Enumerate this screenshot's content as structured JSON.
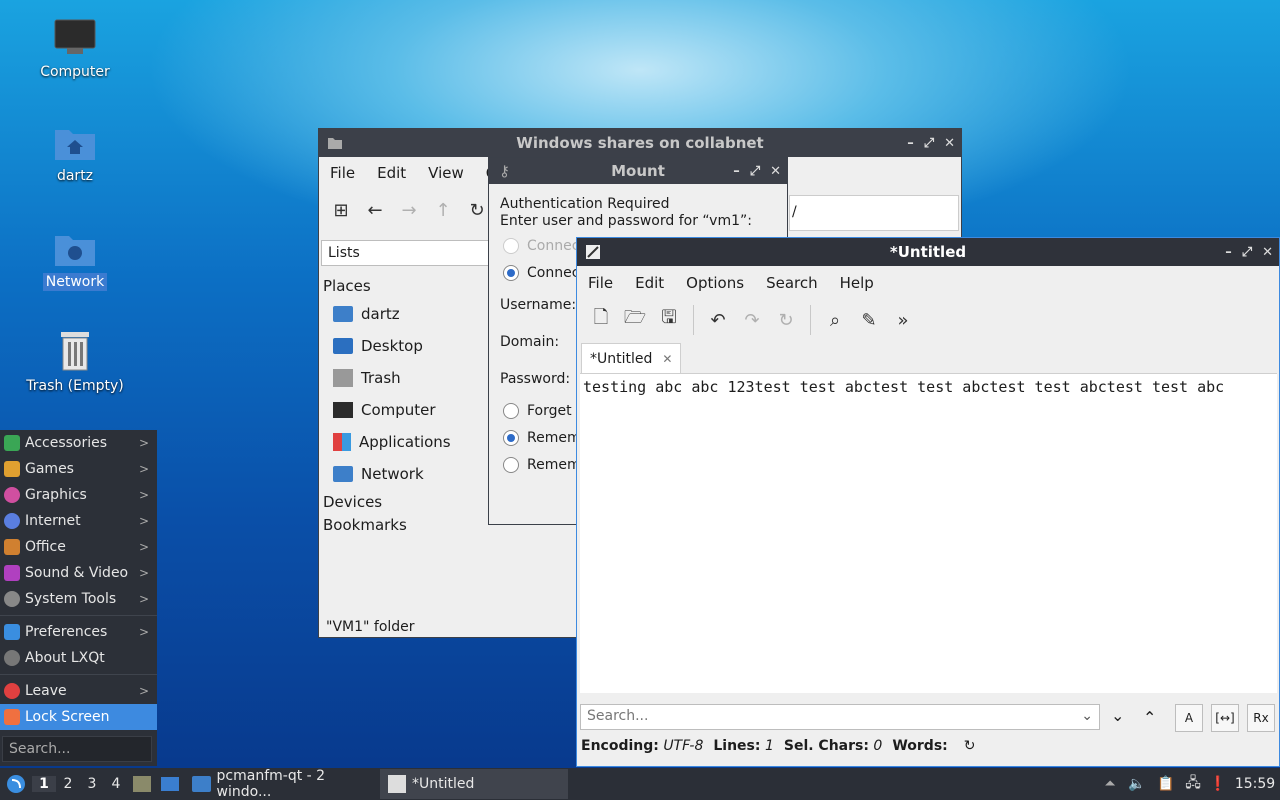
{
  "desktop": {
    "icons": [
      {
        "label": "Computer"
      },
      {
        "label": "dartz"
      },
      {
        "label": "Network"
      },
      {
        "label": "Trash (Empty)"
      }
    ]
  },
  "filemanager": {
    "title": "Windows shares on collabnet",
    "menu": [
      "File",
      "Edit",
      "View",
      "Go"
    ],
    "sidepane_mode": "Lists",
    "places_header": "Places",
    "places": [
      "dartz",
      "Desktop",
      "Trash",
      "Computer",
      "Applications",
      "Network"
    ],
    "devices_header": "Devices",
    "bookmarks_header": "Bookmarks",
    "path_fragment": "/",
    "status": "\"VM1\" folder"
  },
  "mount": {
    "title": "Mount",
    "line1": "Authentication Required",
    "line2": "Enter user and password for “vm1”:",
    "radio_anon": "Connec",
    "radio_user": "Connec",
    "username_label": "Username:",
    "domain_label": "Domain:",
    "password_label": "Password:",
    "opt_forget": "Forget p",
    "opt_remember1": "Remem",
    "opt_remember2": "Remem"
  },
  "editor": {
    "title": "*Untitled",
    "menu": [
      "File",
      "Edit",
      "Options",
      "Search",
      "Help"
    ],
    "tab_label": "*Untitled",
    "text": "testing abc abc 123test test abctest test abctest test abctest test abc",
    "search_placeholder": "Search...",
    "status": {
      "encoding_label": "Encoding:",
      "encoding_value": "UTF-8",
      "lines_label": "Lines:",
      "lines_value": "1",
      "selchars_label": "Sel. Chars:",
      "selchars_value": "0",
      "words_label": "Words:"
    }
  },
  "startmenu": {
    "items": [
      {
        "label": "Accessories",
        "color": "#3aa655"
      },
      {
        "label": "Games",
        "color": "#e0a030"
      },
      {
        "label": "Graphics",
        "color": "#d04fa0"
      },
      {
        "label": "Internet",
        "color": "#5a7ee0"
      },
      {
        "label": "Office",
        "color": "#d08030"
      },
      {
        "label": "Sound & Video",
        "color": "#b040c0"
      },
      {
        "label": "System Tools",
        "color": "#888888"
      }
    ],
    "preferences": "Preferences",
    "about": "About LXQt",
    "leave": "Leave",
    "lock": "Lock Screen",
    "search_placeholder": "Search..."
  },
  "taskbar": {
    "desktops": [
      "1",
      "2",
      "3",
      "4"
    ],
    "tasks": [
      {
        "label": "pcmanfm-qt - 2 windo..."
      },
      {
        "label": "*Untitled"
      }
    ],
    "clock": "15:59"
  }
}
